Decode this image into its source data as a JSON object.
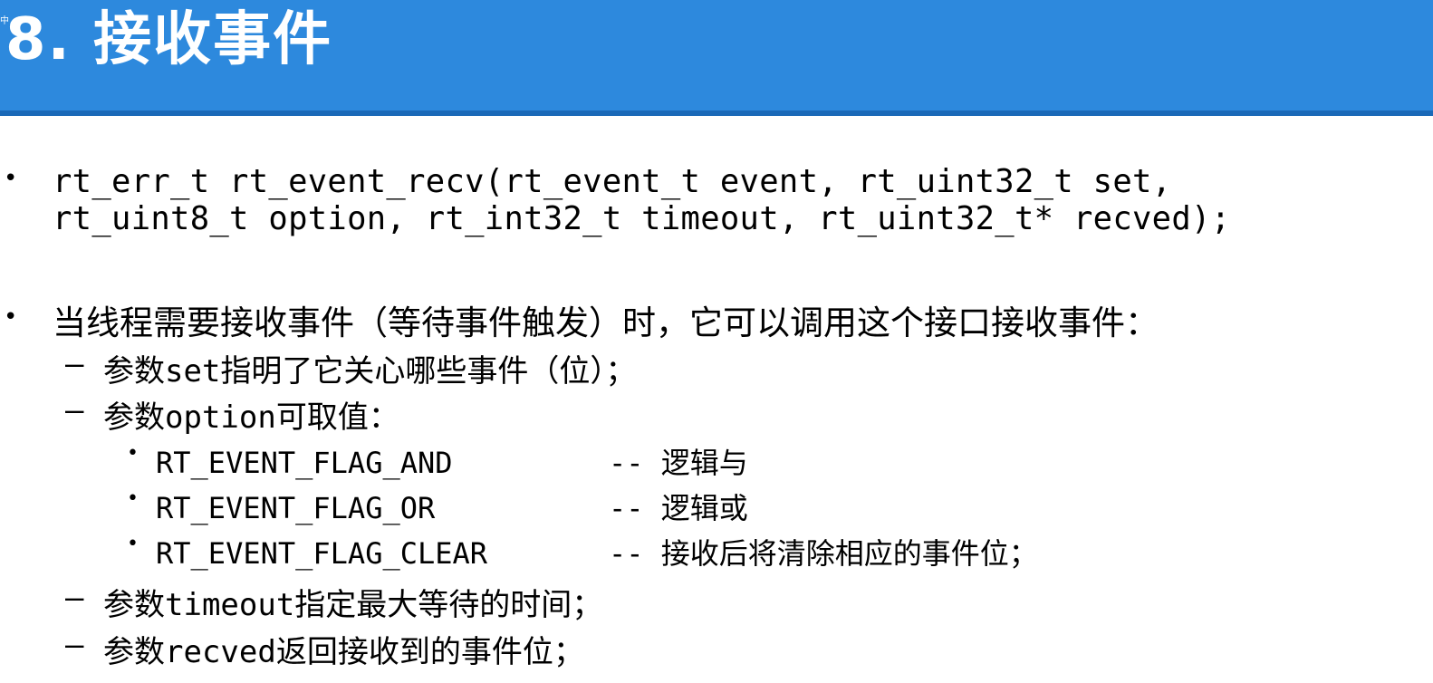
{
  "header": {
    "corner_mark": "中",
    "title": "8. 接收事件"
  },
  "content": {
    "signature_line1": "rt_err_t rt_event_recv(rt_event_t event, rt_uint32_t set,",
    "signature_line2": "rt_uint8_t option, rt_int32_t timeout, rt_uint32_t* recved);",
    "description": "当线程需要接收事件（等待事件触发）时，它可以调用这个接口接收事件：",
    "param_set": "参数set指明了它关心哪些事件（位）；",
    "param_option": "参数option可取值：",
    "options": [
      {
        "flag": "RT_EVENT_FLAG_AND",
        "desc": "-- 逻辑与"
      },
      {
        "flag": "RT_EVENT_FLAG_OR",
        "desc": "-- 逻辑或"
      },
      {
        "flag": "RT_EVENT_FLAG_CLEAR",
        "desc": "-- 接收后将清除相应的事件位；"
      }
    ],
    "param_timeout": "参数timeout指定最大等待的时间；",
    "param_recved": "参数recved返回接收到的事件位；"
  }
}
